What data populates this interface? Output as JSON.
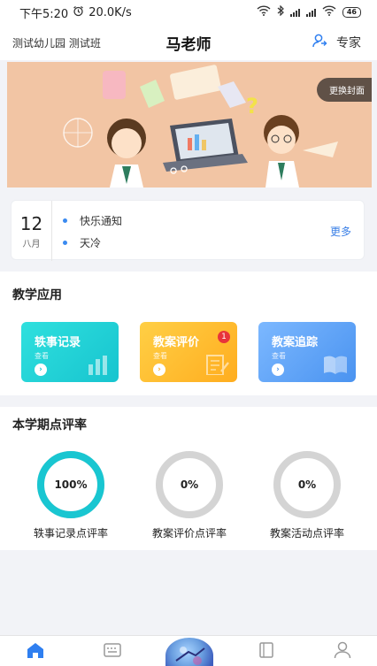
{
  "status": {
    "time": "下午5:20",
    "speed": "20.0K/s",
    "battery": "46"
  },
  "header": {
    "school": "测试幼儿园 测试班",
    "title": "马老师",
    "expert_label": "专家"
  },
  "banner": {
    "change_cover_label": "更换封面"
  },
  "notice": {
    "day": "12",
    "month": "八月",
    "items": [
      "快乐通知",
      "天冷"
    ],
    "more_label": "更多"
  },
  "apps": {
    "section_title": "教学应用",
    "cards": [
      {
        "title": "轶事记录",
        "sub": "查看",
        "color_from": "#2fe0de",
        "color_to": "#17c4cf"
      },
      {
        "title": "教案评价",
        "sub": "查看",
        "badge": "1",
        "color_from": "#ffcf45",
        "color_to": "#ffad1f"
      },
      {
        "title": "教案追踪",
        "sub": "查看",
        "color_from": "#7cb8ff",
        "color_to": "#4a93f0"
      }
    ]
  },
  "rates": {
    "section_title": "本学期点评率",
    "items": [
      {
        "value": "100%",
        "label": "轶事记录点评率",
        "fraction": 1.0
      },
      {
        "value": "0%",
        "label": "教案评价点评率",
        "fraction": 0.0
      },
      {
        "value": "0%",
        "label": "教案活动点评率",
        "fraction": 0.0
      }
    ],
    "ring_color": "#19c6d1",
    "track_color": "#d4d4d4"
  },
  "tabbar": {
    "active_color": "#2f7ff0",
    "inactive_color": "#999999"
  }
}
